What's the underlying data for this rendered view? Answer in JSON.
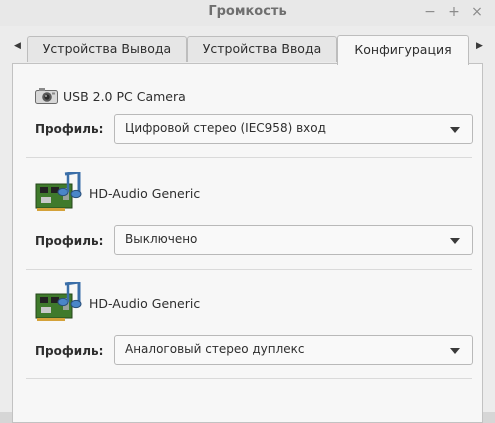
{
  "window": {
    "title": "Громкость",
    "controls": {
      "minimize": "−",
      "maximize": "+",
      "close": "×"
    }
  },
  "tabs": [
    {
      "label": "Устройства Вывода",
      "active": false
    },
    {
      "label": "Устройства Ввода",
      "active": false
    },
    {
      "label": "Конфигурация",
      "active": true
    }
  ],
  "tab_scroll": {
    "left": "◀",
    "right": "▶"
  },
  "devices": [
    {
      "name": "USB 2.0 PC Camera",
      "icon": "camera-icon",
      "profile_label": "Профиль:",
      "profile": "Цифровой стерео (IEC958) вход"
    },
    {
      "name": "HD-Audio Generic",
      "icon": "sound-card-icon",
      "profile_label": "Профиль:",
      "profile": "Выключено"
    },
    {
      "name": "HD-Audio Generic",
      "icon": "sound-card-icon",
      "profile_label": "Профиль:",
      "profile": "Аналоговый стерео дуплекс"
    }
  ]
}
